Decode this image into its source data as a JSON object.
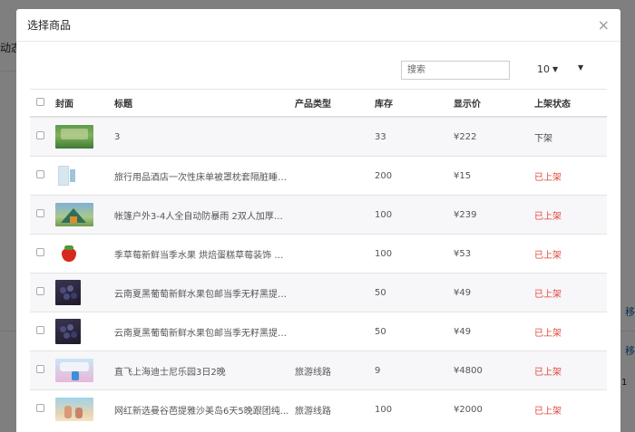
{
  "background": {
    "left_tab": "动态",
    "right_link_1": "移",
    "right_link_2": "移",
    "pager_char": "1"
  },
  "modal": {
    "title": "选择商品",
    "close_icon": "×"
  },
  "toolbar": {
    "search_placeholder": "搜索",
    "page_size": "10"
  },
  "table": {
    "headers": {
      "cover": "封面",
      "title": "标题",
      "type": "产品类型",
      "stock": "库存",
      "price": "显示价",
      "status": "上架状态"
    },
    "rows": [
      {
        "title": "3",
        "type": "",
        "stock": "33",
        "price": "¥222",
        "status": "下架",
        "on": false,
        "thumb": "forest"
      },
      {
        "title": "旅行用品酒店一次性床单被罩枕套隔脏睡袋...",
        "type": "",
        "stock": "200",
        "price": "¥15",
        "status": "已上架",
        "on": true,
        "thumb": "package"
      },
      {
        "title": "帐篷户外3-4人全自动防暴雨 2双人加厚防...",
        "type": "",
        "stock": "100",
        "price": "¥239",
        "status": "已上架",
        "on": true,
        "thumb": "tent"
      },
      {
        "title": "季草莓新鲜当季水果 烘焙蛋糕草莓装饰 批...",
        "type": "",
        "stock": "100",
        "price": "¥53",
        "status": "已上架",
        "on": true,
        "thumb": "strawberry"
      },
      {
        "title": "云南夏黑葡萄新鲜水果包邮当季无籽黑提整...",
        "type": "",
        "stock": "50",
        "price": "¥49",
        "status": "已上架",
        "on": true,
        "thumb": "grapes"
      },
      {
        "title": "云南夏黑葡萄新鲜水果包邮当季无籽黑提整...",
        "type": "",
        "stock": "50",
        "price": "¥49",
        "status": "已上架",
        "on": true,
        "thumb": "grapes"
      },
      {
        "title": "直飞上海迪士尼乐园3日2晚",
        "type": "旅游线路",
        "stock": "9",
        "price": "¥4800",
        "status": "已上架",
        "on": true,
        "thumb": "disney"
      },
      {
        "title": "网红新选曼谷芭提雅沙美岛6天5晚跟团纯...",
        "type": "旅游线路",
        "stock": "100",
        "price": "¥2000",
        "status": "已上架",
        "on": true,
        "thumb": "beach"
      }
    ]
  },
  "colors": {
    "status_on": "#e0463a",
    "status_off": "#444444",
    "overlay": "rgba(0,0,0,0.5)"
  }
}
